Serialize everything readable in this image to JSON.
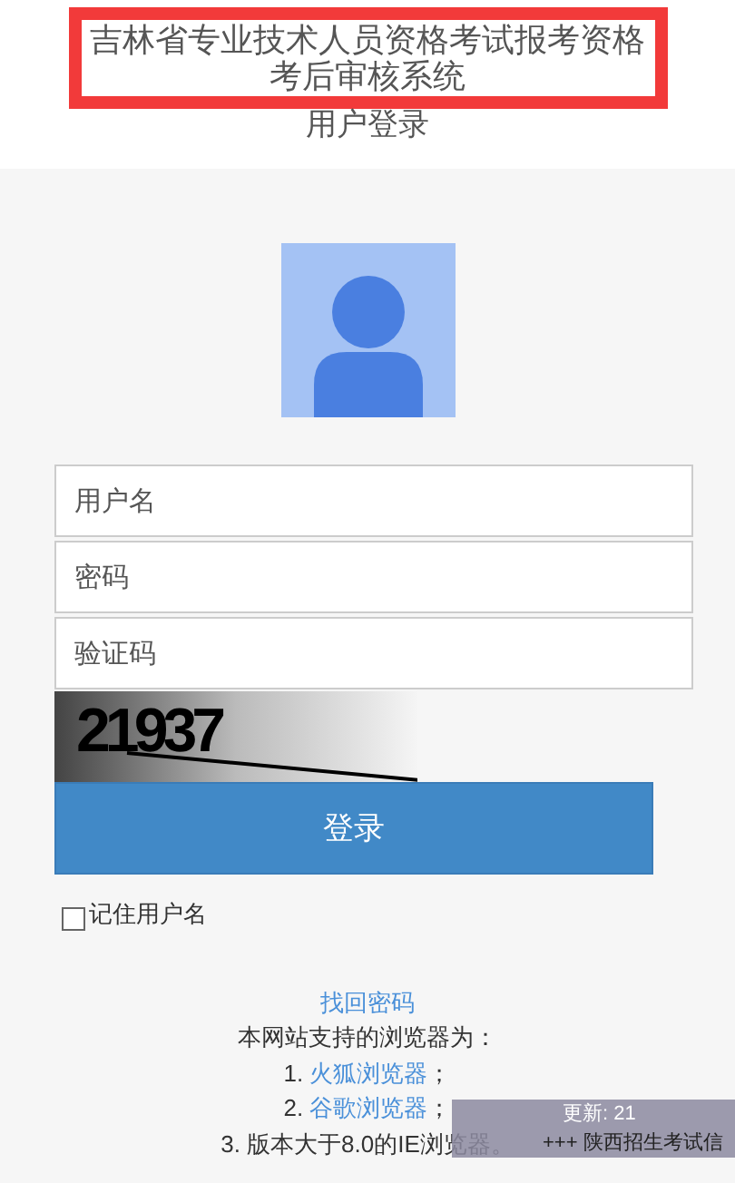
{
  "header": {
    "title": "吉林省专业技术人员资格考试报考资格考后审核系统",
    "subtitle": "用户登录"
  },
  "form": {
    "fields": [
      {
        "placeholder": "用户名"
      },
      {
        "placeholder": "密码"
      },
      {
        "placeholder": "验证码"
      }
    ],
    "captcha": "21937",
    "login_button": "登录",
    "remember": {
      "label": "记住用户名",
      "checked": false
    }
  },
  "footer": {
    "recover_link": "找回密码",
    "browsers_intro": "本网站支持的浏览器为：",
    "browsers": [
      {
        "prefix": "1. ",
        "link": "火狐浏览器",
        "suffix": "；"
      },
      {
        "prefix": "2. ",
        "link": "谷歌浏览器",
        "suffix": "；"
      },
      {
        "prefix": "3. 版本大于8.0的IE浏览器。"
      }
    ]
  },
  "notice": {
    "update": "更新: 21",
    "ticker": "+++ 陕西招生考试信"
  }
}
